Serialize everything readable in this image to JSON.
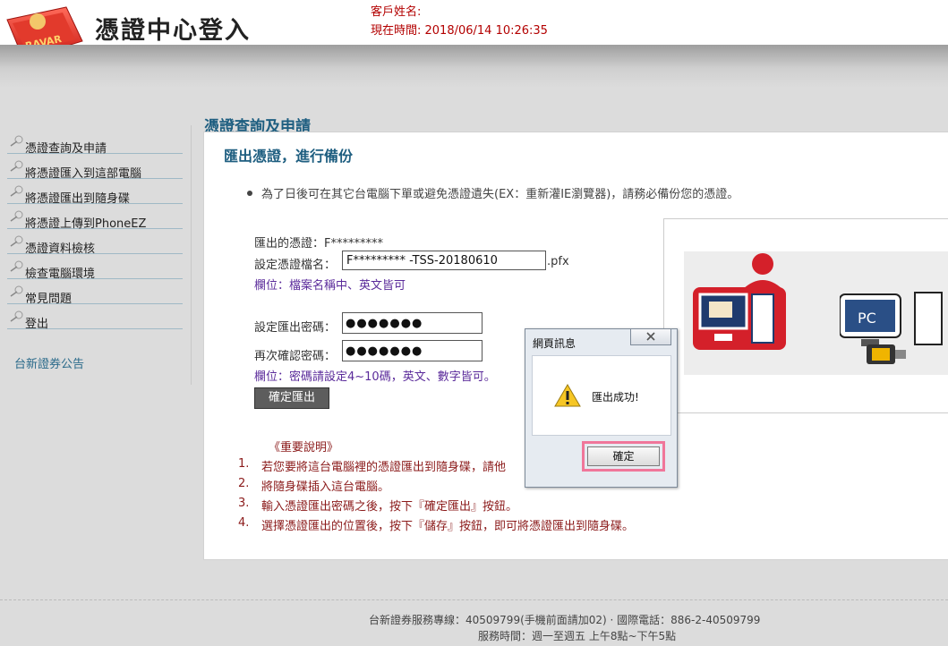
{
  "header": {
    "brand_title": "憑證中心登入",
    "logo_text": "RAVAR",
    "customer_label": "客戶姓名:",
    "time_label": "現在時間: 2018/06/14 10:26:35"
  },
  "sidebar": {
    "items": [
      {
        "label": "憑證查詢及申請"
      },
      {
        "label": "將憑證匯入到這部電腦"
      },
      {
        "label": "將憑證匯出到隨身碟"
      },
      {
        "label": "將憑證上傳到PhoneEZ"
      },
      {
        "label": "憑證資料檢核"
      },
      {
        "label": "檢查電腦環境"
      },
      {
        "label": "常見問題"
      },
      {
        "label": "登出"
      }
    ],
    "news": "台新證券公告"
  },
  "main": {
    "title": "憑證查詢及申請",
    "subtitle": "匯出憑證，進行備份",
    "bullet": "為了日後可在其它台電腦下單或避免憑證遺失(EX：重新灌IE瀏覽器)，請務必備份您的憑證。",
    "cert_label": "匯出的憑證：F*********",
    "filename_label": "設定憑證檔名：",
    "filename_value": "F********* -TSS-20180610",
    "filename_ext": ".pfx",
    "filename_note": "欄位：檔案名稱中、英文皆可",
    "pwd_label": "設定匯出密碼：",
    "pwd_value": "●●●●●●●",
    "confirm_label": "再次確認密碼：",
    "confirm_value": "●●●●●●●",
    "pwd_note": "欄位：密碼請設定4~10碼，英文、數字皆可。",
    "export_button": "確定匯出",
    "important_title": "《重要說明》",
    "steps": [
      {
        "num": "1.",
        "text": "若您要將這台電腦裡的憑證匯出到隨身碟，請他"
      },
      {
        "num": "2.",
        "text": "將隨身碟插入這台電腦。"
      },
      {
        "num": "3.",
        "text": "輸入憑證匯出密碼之後，按下『確定匯出』按鈕。"
      },
      {
        "num": "4.",
        "text": "選擇憑證匯出的位置後，按下『儲存』按鈕，即可將憑證匯出到隨身碟。"
      }
    ],
    "illus_pc_label": "PC"
  },
  "dialog": {
    "title": "網頁訊息",
    "message": "匯出成功!",
    "ok_button": "確定"
  },
  "footer": {
    "line1": "台新證券服務專線：40509799(手機前面請加02) · 國際電話：886-2-40509799",
    "line2": "服務時間：週一至週五 上午8點~下午5點"
  },
  "colors": {
    "accent": "#1e5e80",
    "alert_red": "#b30000",
    "note_purple": "#5a2a9a",
    "step_red": "#8b1a1a",
    "highlight_pink": "#f0769a"
  },
  "icons": {
    "logo": "ravar-card-logo-icon",
    "sidebar_item": "pushpin-icon",
    "dialog_warning": "warning-icon",
    "dialog_close": "close-icon"
  }
}
